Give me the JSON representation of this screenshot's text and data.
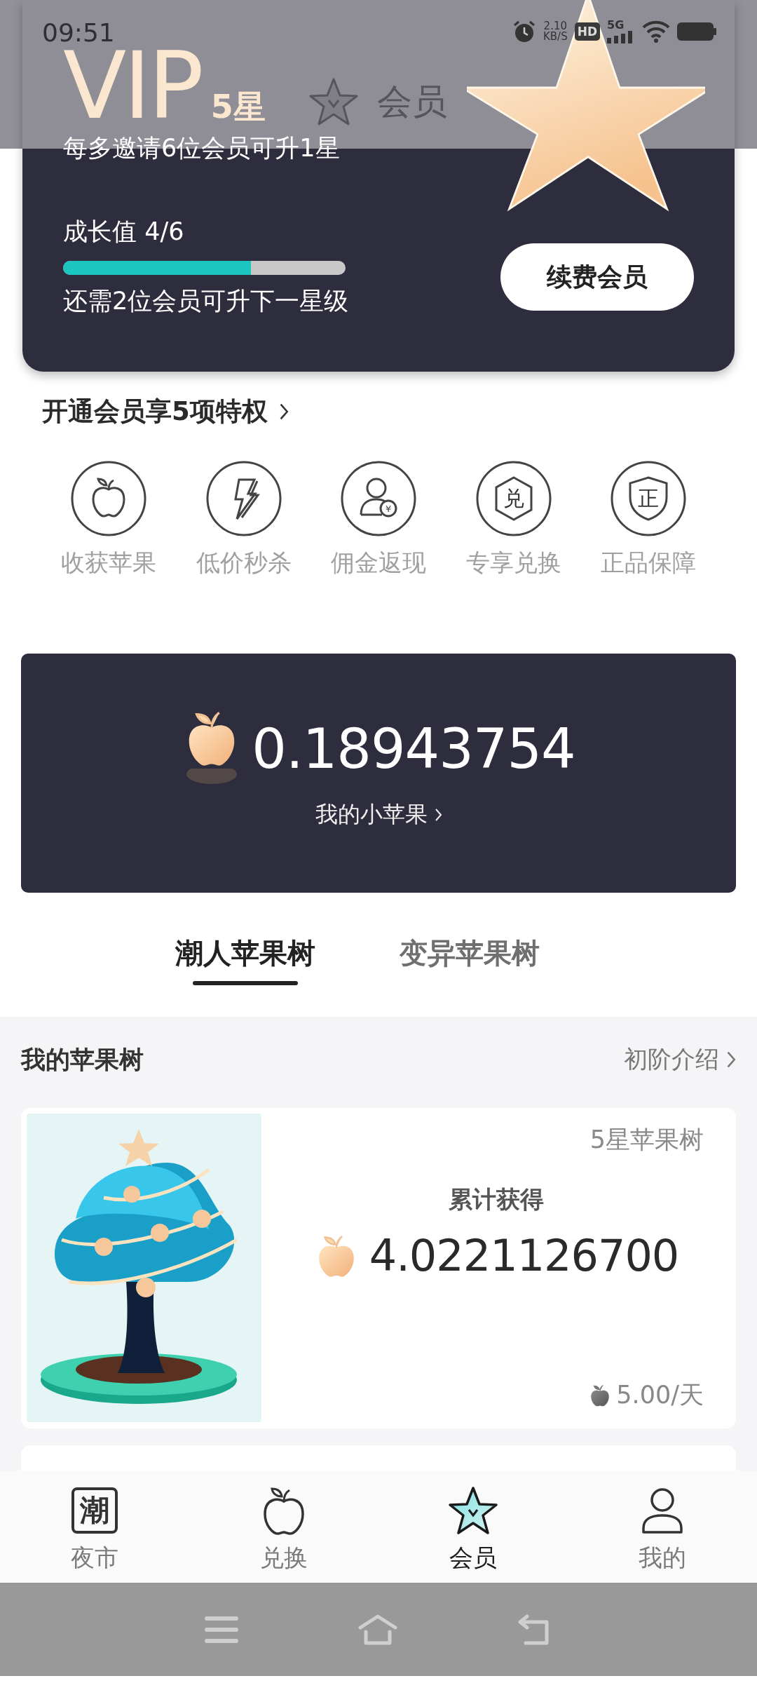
{
  "status_bar": {
    "time": "09:51",
    "net_speed": "2.10",
    "net_unit": "KB/S",
    "hd_badge": "HD",
    "network": "5G"
  },
  "header": {
    "title": "会员"
  },
  "vip_card": {
    "title": "VIP",
    "stars_label": "5星",
    "invite_rule": "每多邀请6位会员可升1星",
    "growth_label": "成长值 4/6",
    "growth": {
      "level": 0.665
    },
    "hint": "还需2位会员可升下一星级",
    "renew_button": "续费会员"
  },
  "privileges": {
    "title": "开通会员享5项特权",
    "items": [
      {
        "kind": "apple",
        "label": "收获苹果"
      },
      {
        "kind": "bolt",
        "label": "低价秒杀"
      },
      {
        "kind": "person",
        "glyph": "¥",
        "label": "佣金返现"
      },
      {
        "kind": "hexagon",
        "glyph": "兑",
        "label": "专享兑换"
      },
      {
        "kind": "shield",
        "glyph": "正",
        "label": "正品保障"
      }
    ]
  },
  "apples": {
    "amount": "0.18943754",
    "link": "我的小苹果"
  },
  "tabs": [
    {
      "label": "潮人苹果树",
      "selected": true
    },
    {
      "label": "变异苹果树",
      "selected": false
    }
  ],
  "my_trees": {
    "title": "我的苹果树",
    "link": "初阶介绍",
    "cards": [
      {
        "grade": "5星苹果树",
        "total_label": "累计获得",
        "total": "4.0221126700",
        "rate": "5.00/天"
      }
    ]
  },
  "bottom_nav": [
    {
      "kind": "tide",
      "glyph": "潮",
      "label": "夜市",
      "selected": false
    },
    {
      "kind": "apple",
      "label": "兑换",
      "selected": false
    },
    {
      "kind": "star",
      "label": "会员",
      "selected": true
    },
    {
      "kind": "person",
      "label": "我的",
      "selected": false
    }
  ]
}
